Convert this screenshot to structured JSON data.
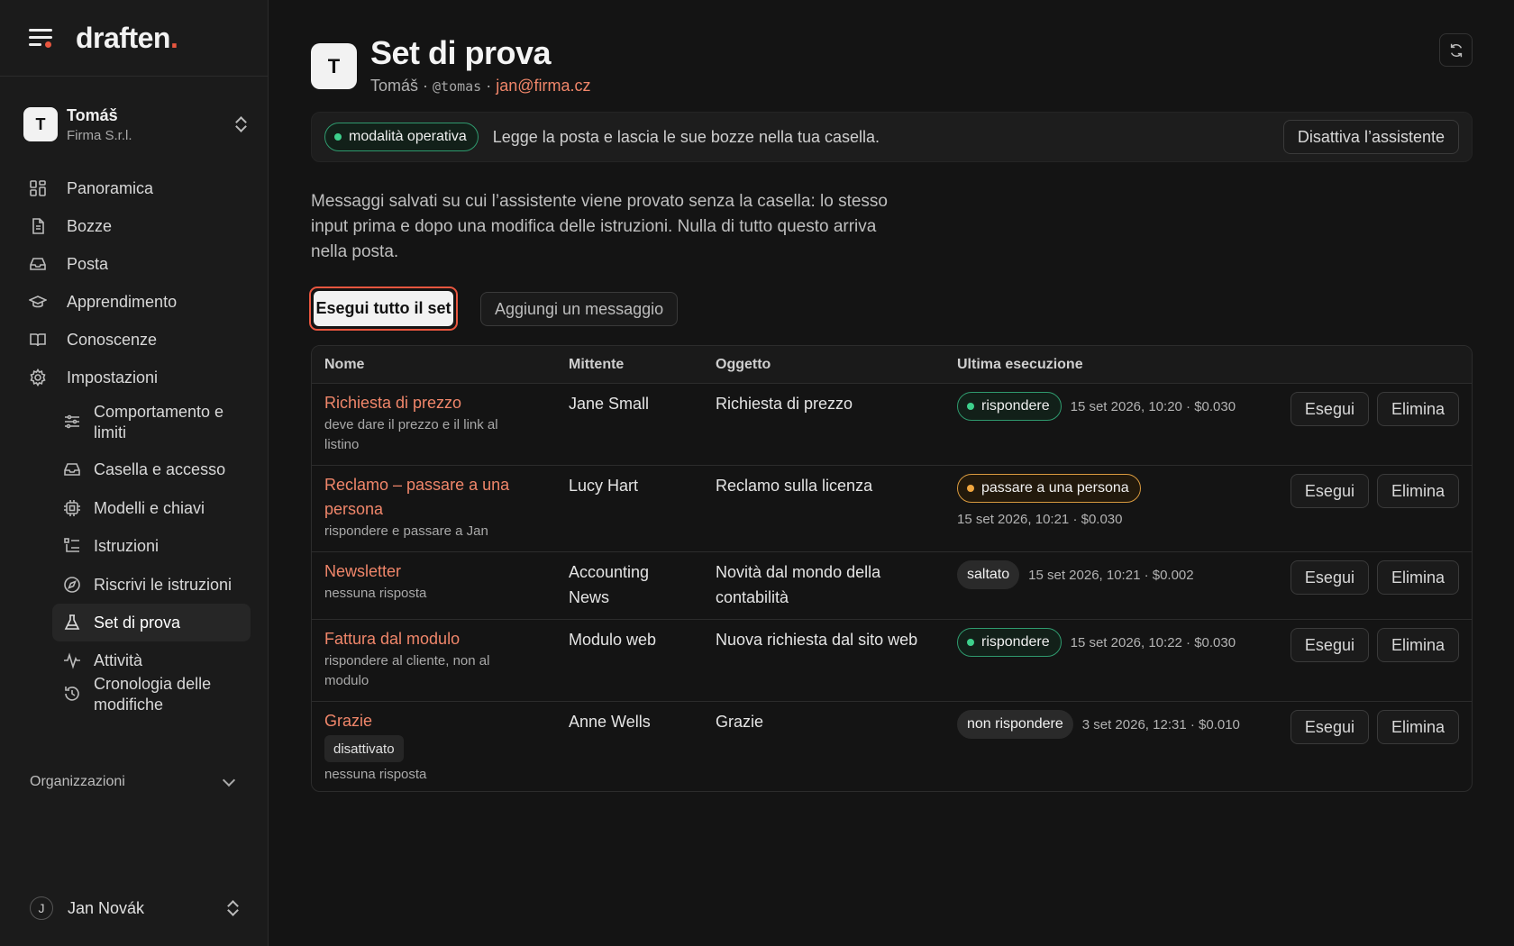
{
  "brand": {
    "name": "draften",
    "dot": "."
  },
  "workspace": {
    "initial": "T",
    "name": "Tomáš",
    "company": "Firma S.r.l."
  },
  "nav": {
    "panoramica": "Panoramica",
    "bozze": "Bozze",
    "posta": "Posta",
    "apprendimento": "Apprendimento",
    "conoscenze": "Conoscenze",
    "impostazioni": "Impostazioni",
    "comportamento": "Comportamento e limiti",
    "casella": "Casella e accesso",
    "modelli": "Modelli e chiavi",
    "istruzioni": "Istruzioni",
    "riscrivi": "Riscrivi le istruzioni",
    "set_prova": "Set di prova",
    "attivita": "Attività",
    "cronologia": "Cronologia delle modifiche"
  },
  "org_label": "Organizzazioni",
  "user": {
    "initial": "J",
    "name": "Jan Novák"
  },
  "page": {
    "initial": "T",
    "title": "Set di prova",
    "owner": "Tomáš ·",
    "handle": "@tomas",
    "sep": "·",
    "email": "jan@firma.cz"
  },
  "mode": {
    "badge": "modalità operativa",
    "text": "Legge la posta e lascia le sue bozze nella tua casella.",
    "button": "Disattiva l’assistente"
  },
  "description": "Messaggi salvati su cui l’assistente viene provato senza la casella: lo stesso input prima e dopo una modifica delle istruzioni. Nulla di tutto questo arriva nella posta.",
  "actions": {
    "run_all": "Esegui tutto il set",
    "add": "Aggiungi un messaggio"
  },
  "table": {
    "headers": {
      "name": "Nome",
      "from": "Mittente",
      "subject": "Oggetto",
      "last_run": "Ultima esecuzione"
    },
    "run_label": "Esegui",
    "delete_label": "Elimina",
    "rows": [
      {
        "name": "Richiesta di prezzo",
        "note": "deve dare il prezzo e il link al listino",
        "from": "Jane Small",
        "subject": "Richiesta di prezzo",
        "status": "rispondere",
        "status_color": "green",
        "meta": "15 set 2026, 10:20 · $0.030"
      },
      {
        "name": "Reclamo – passare a una persona",
        "note": "rispondere e passare a Jan",
        "from": "Lucy Hart",
        "subject": "Reclamo sulla licenza",
        "status": "passare a una persona",
        "status_color": "orange",
        "meta": "15 set 2026, 10:21 · $0.030"
      },
      {
        "name": "Newsletter",
        "note": "nessuna risposta",
        "from": "Accounting News",
        "subject": "Novità dal mondo della contabilità",
        "status": "saltato",
        "status_color": "gray",
        "meta": "15 set 2026, 10:21 · $0.002"
      },
      {
        "name": "Fattura dal modulo",
        "note": "rispondere al cliente, non al modulo",
        "from": "Modulo web",
        "subject": "Nuova richiesta dal sito web",
        "status": "rispondere",
        "status_color": "green",
        "meta": "15 set 2026, 10:22 · $0.030"
      },
      {
        "name": "Grazie",
        "tag": "disattivato",
        "note": "nessuna risposta",
        "from": "Anne Wells",
        "subject": "Grazie",
        "status": "non rispondere",
        "status_color": "gray",
        "meta": "3 set 2026, 12:31 · $0.010"
      }
    ]
  },
  "colors": {
    "accent": "#e8563f",
    "link": "#f0866a",
    "green": "#3dd08c",
    "orange": "#f0a63f"
  }
}
